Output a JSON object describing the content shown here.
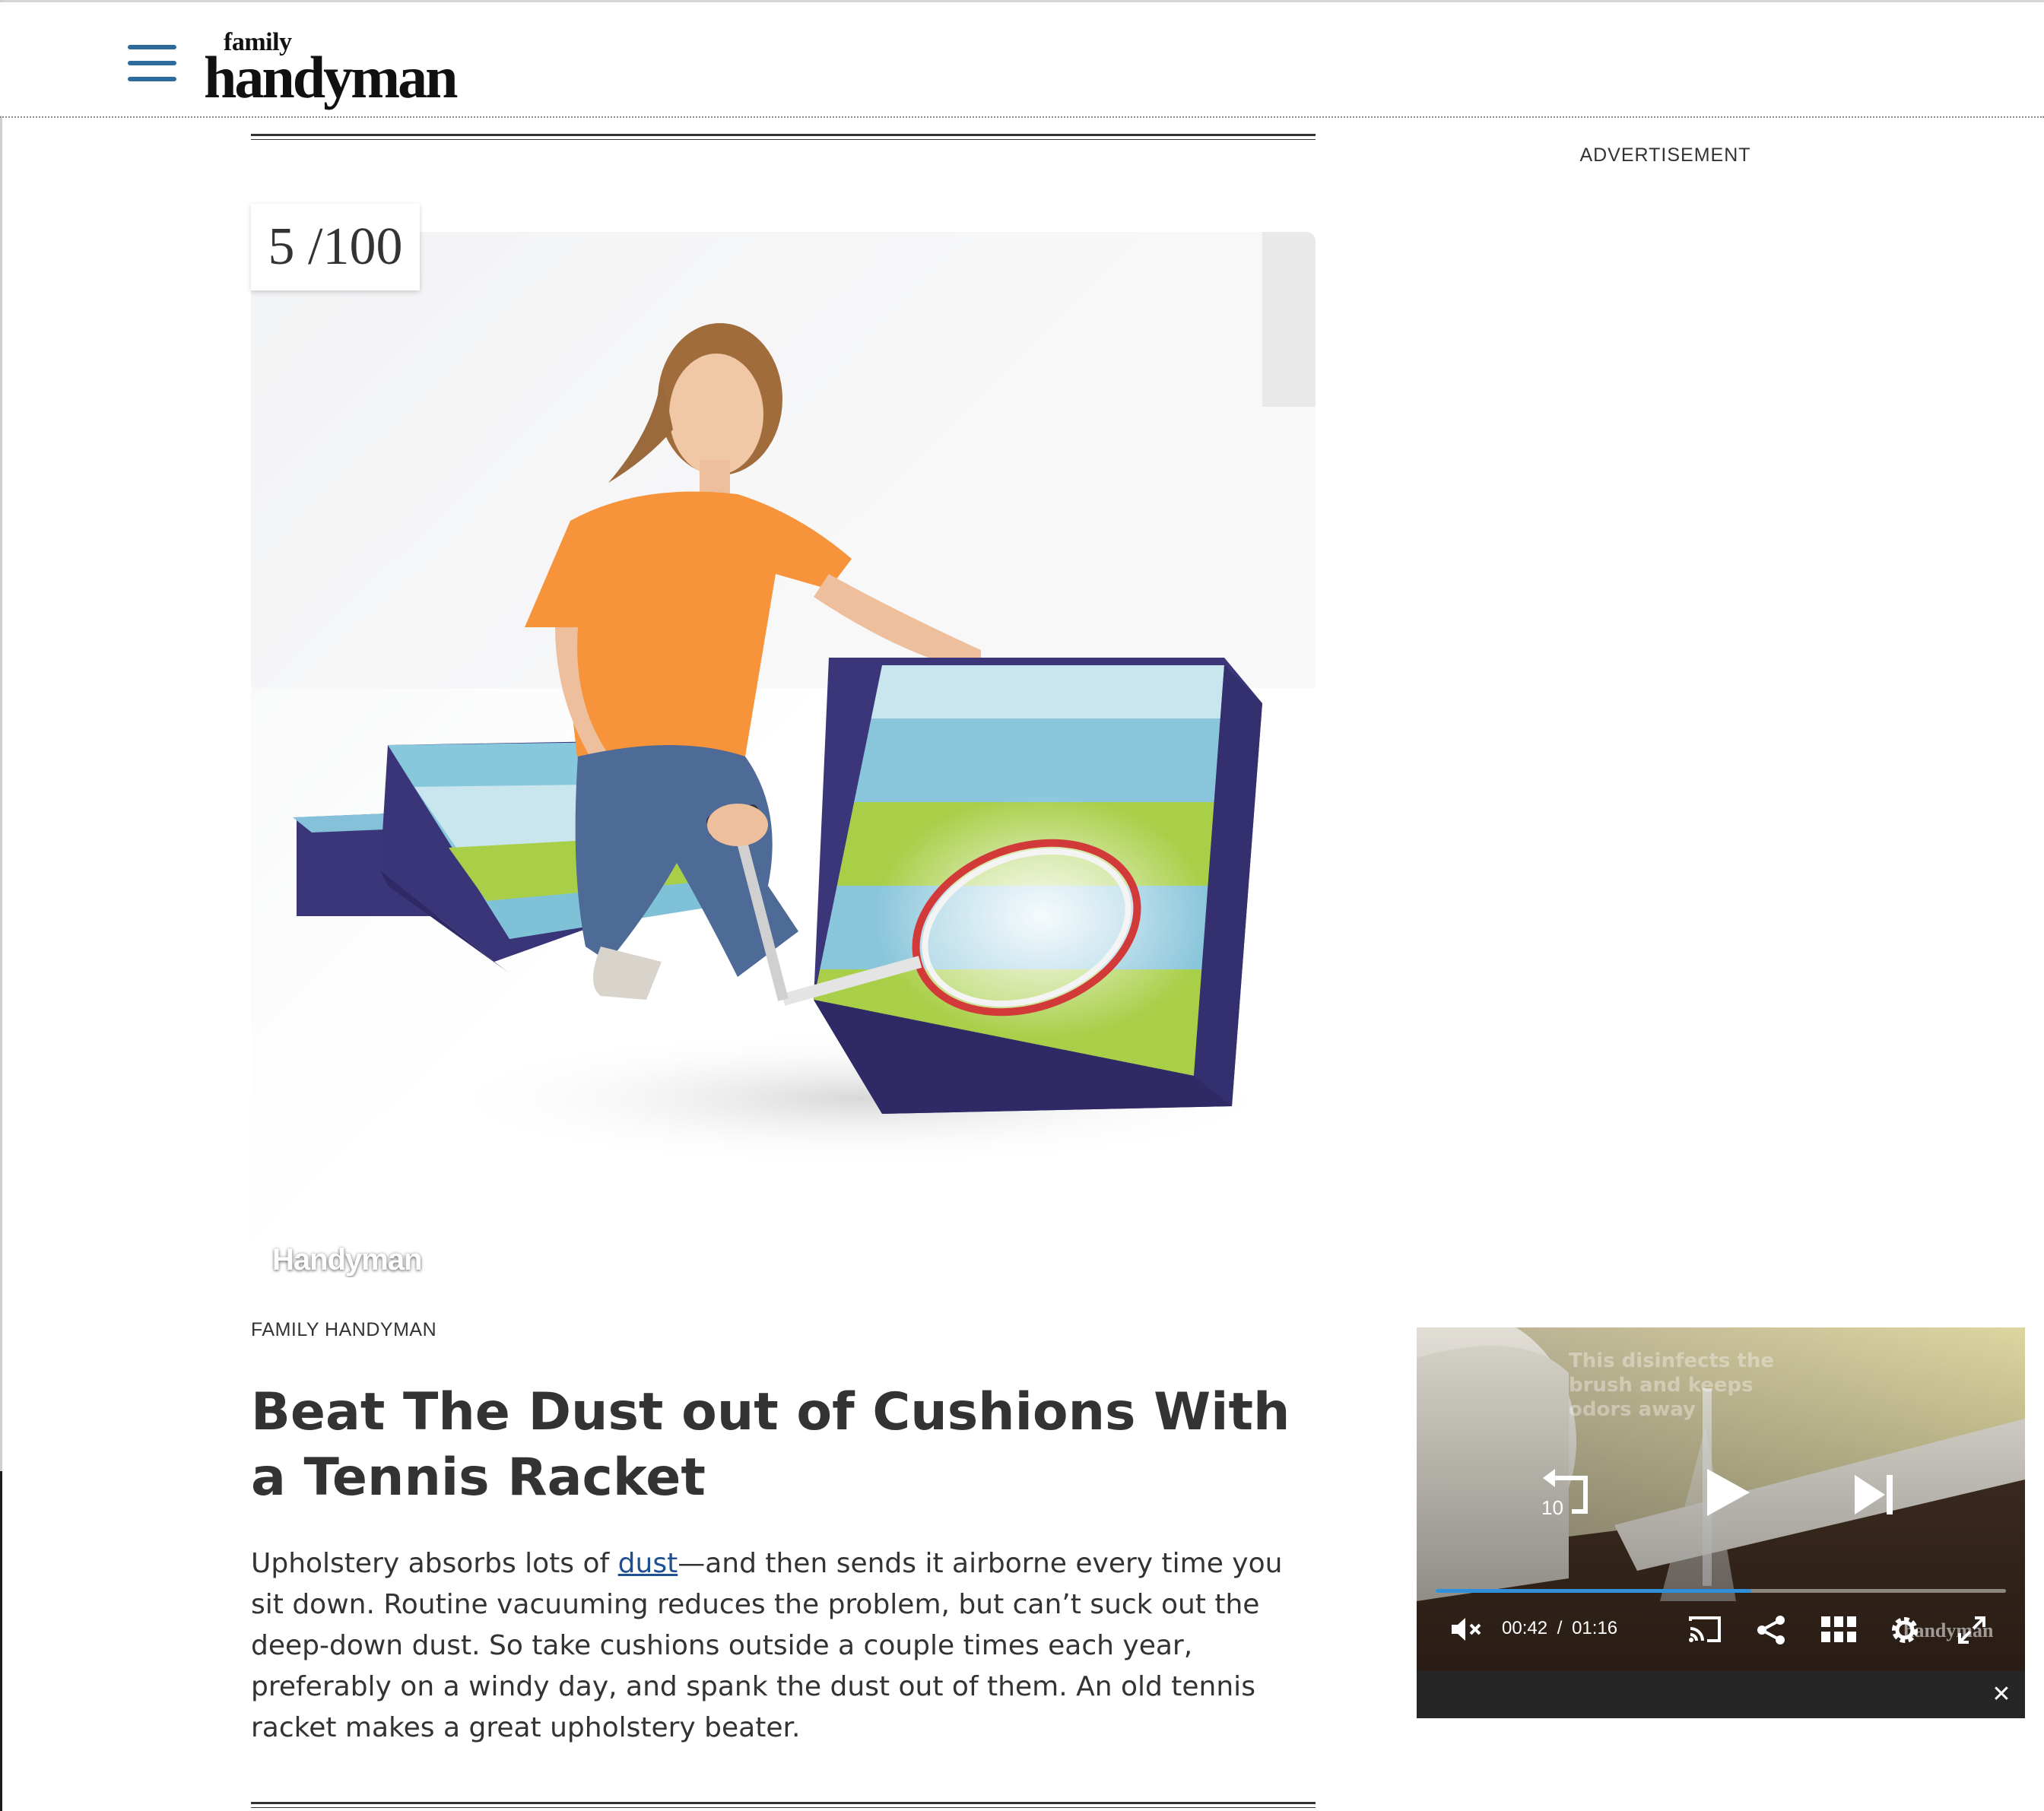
{
  "header": {
    "logo_small": "family",
    "logo_large": "handyman",
    "menu_icon": "hamburger-menu-icon"
  },
  "sidebar": {
    "ad_label": "ADVERTISEMENT"
  },
  "slide": {
    "counter": "5 /100",
    "image_watermark": "Handyman",
    "credit": "FAMILY HANDYMAN",
    "title": "Beat The Dust out of Cushions With a Tennis Racket",
    "body_before_link": "Upholstery absorbs lots of ",
    "body_link": "dust",
    "body_after_link": "—and then sends it airborne every time you sit down. Routine vacuuming reduces the problem, but can’t suck out the deep-down dust. So take cushions outside a couple times each year, preferably on a windy day, and spank the dust out of them. An old tennis racket makes a great upholstery beater."
  },
  "video_player": {
    "overlay_text": "This disinfects the brush and keeps odors away",
    "replay_label": "10",
    "current_time": "00:42",
    "time_separator": "/",
    "duration": "01:16",
    "progress_fraction": 0.553,
    "watermark": "handyman",
    "close_label": "✕",
    "icons": [
      "replay-10-icon",
      "play-icon",
      "skip-next-icon",
      "mute-icon",
      "cast-icon",
      "share-icon",
      "grid-icon",
      "settings-icon",
      "fullscreen-icon"
    ]
  },
  "colors": {
    "accent": "#2f6b9a",
    "link": "#1d4f91",
    "progress": "#2f8fd8",
    "text": "#333333"
  }
}
